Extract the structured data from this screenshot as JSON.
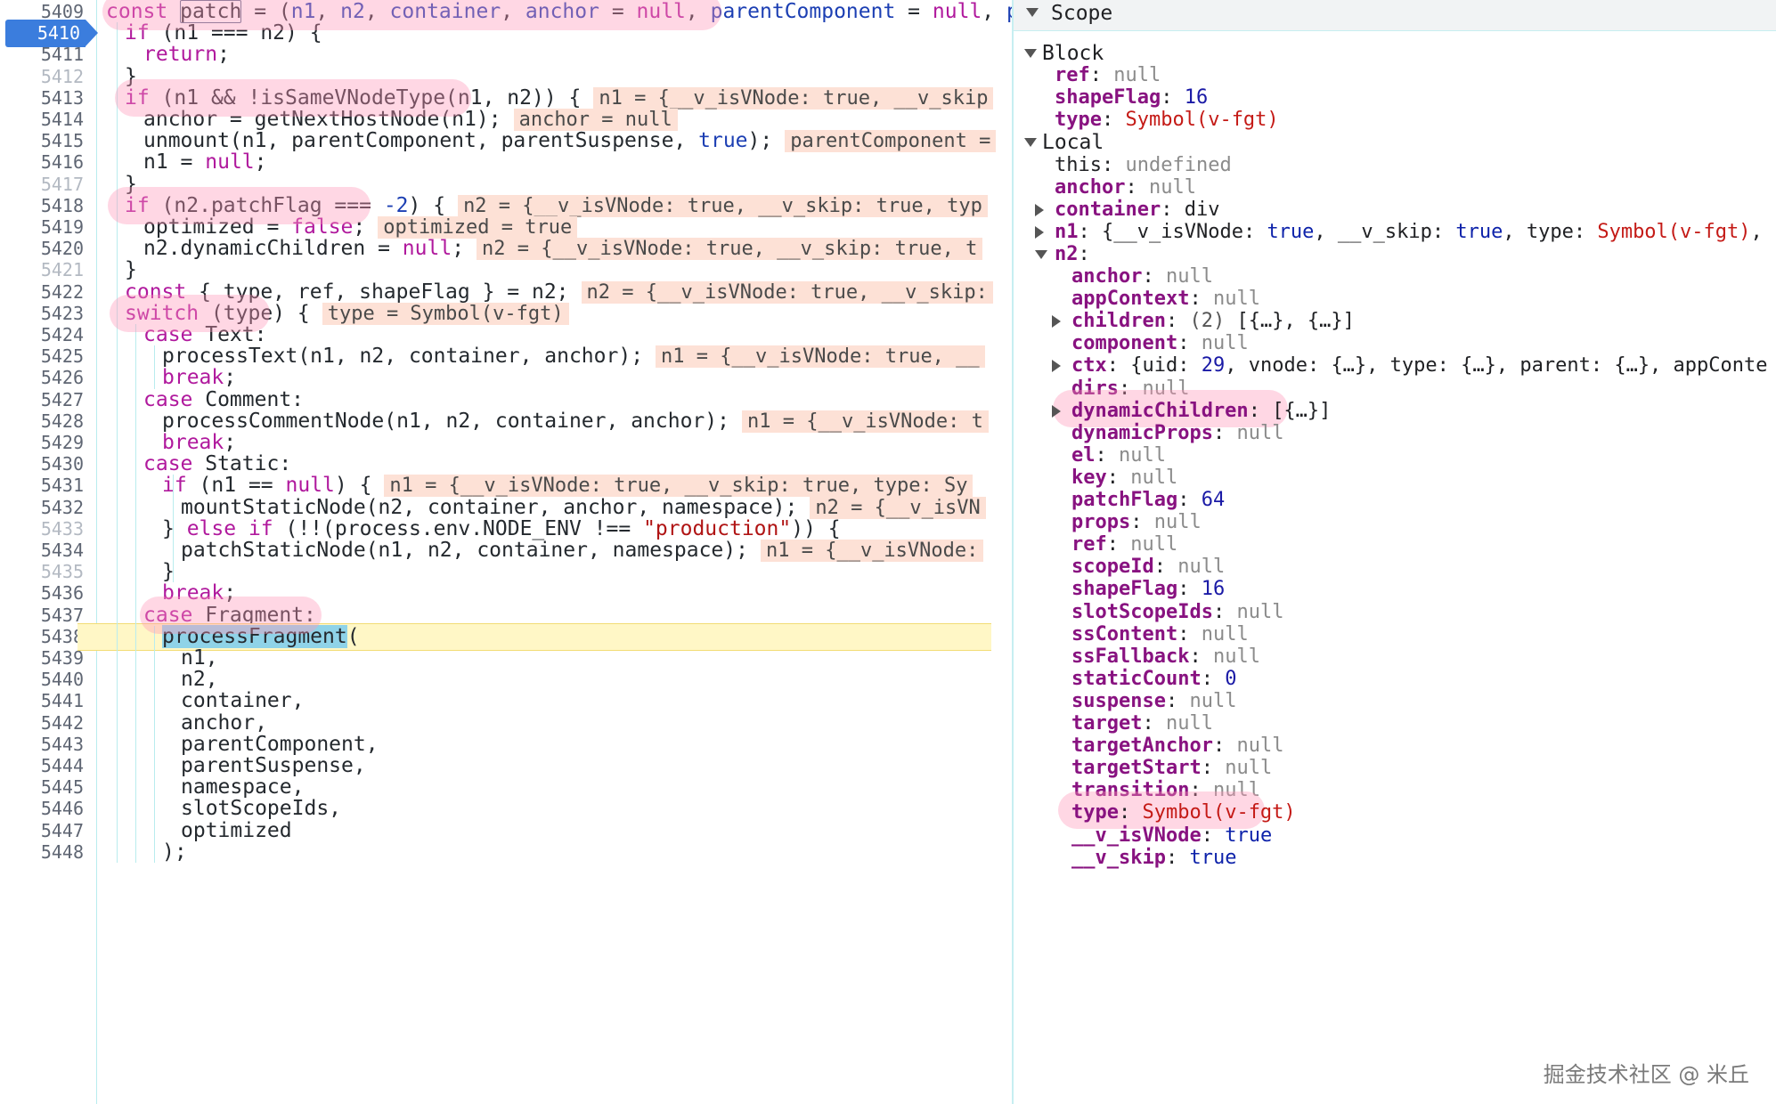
{
  "editor": {
    "active_line": "5410",
    "lines": [
      {
        "n": "5409",
        "dim": false,
        "indent": 0,
        "tokens": [
          [
            "kw",
            "const "
          ],
          [
            "boxfn",
            "patch"
          ],
          [
            "p",
            " = ("
          ],
          [
            "param",
            "n1"
          ],
          [
            "p",
            ", "
          ],
          [
            "param",
            "n2"
          ],
          [
            "p",
            ", "
          ],
          [
            "param",
            "container"
          ],
          [
            "p",
            ", "
          ],
          [
            "param",
            "anchor"
          ],
          [
            "p",
            " = "
          ],
          [
            "kw",
            "null"
          ],
          [
            "p",
            ", "
          ],
          [
            "param",
            "parentComponent"
          ],
          [
            "p",
            " = "
          ],
          [
            "kw",
            "null"
          ],
          [
            "p",
            ", "
          ],
          [
            "param",
            "pa"
          ]
        ],
        "inline": ""
      },
      {
        "n": "5410",
        "dim": false,
        "indent": 1,
        "tokens": [
          [
            "kw",
            "if"
          ],
          [
            "p",
            " (n1 === n2) {"
          ]
        ],
        "inline": ""
      },
      {
        "n": "5411",
        "dim": false,
        "indent": 2,
        "tokens": [
          [
            "kw",
            "return"
          ],
          [
            "p",
            ";"
          ]
        ],
        "inline": ""
      },
      {
        "n": "5412",
        "dim": true,
        "indent": 1,
        "tokens": [
          [
            "p",
            "}"
          ]
        ],
        "inline": ""
      },
      {
        "n": "5413",
        "dim": false,
        "indent": 1,
        "tokens": [
          [
            "kw",
            "if"
          ],
          [
            "p",
            " (n1 && !isSameVNodeType(n1, n2)) {"
          ]
        ],
        "inline": "n1 = {__v_isVNode: true, __v_skip"
      },
      {
        "n": "5414",
        "dim": false,
        "indent": 2,
        "tokens": [
          [
            "p",
            "anchor = getNextHostNode(n1);"
          ]
        ],
        "inline": "anchor = null"
      },
      {
        "n": "5415",
        "dim": false,
        "indent": 2,
        "tokens": [
          [
            "p",
            "unmount(n1, parentComponent, parentSuspense, "
          ],
          [
            "lit",
            "true"
          ],
          [
            "p",
            ");"
          ]
        ],
        "inline": "parentComponent ="
      },
      {
        "n": "5416",
        "dim": false,
        "indent": 2,
        "tokens": [
          [
            "p",
            "n1 = "
          ],
          [
            "kw",
            "null"
          ],
          [
            "p",
            ";"
          ]
        ],
        "inline": ""
      },
      {
        "n": "5417",
        "dim": true,
        "indent": 1,
        "tokens": [
          [
            "p",
            "}"
          ]
        ],
        "inline": ""
      },
      {
        "n": "5418",
        "dim": false,
        "indent": 1,
        "tokens": [
          [
            "kw",
            "if"
          ],
          [
            "p",
            " (n2.patchFlag === "
          ],
          [
            "num",
            "-2"
          ],
          [
            "p",
            ") {"
          ]
        ],
        "inline": "n2 = {__v_isVNode: true, __v_skip: true, typ"
      },
      {
        "n": "5419",
        "dim": false,
        "indent": 2,
        "tokens": [
          [
            "p",
            "optimized = "
          ],
          [
            "kw",
            "false"
          ],
          [
            "p",
            ";"
          ]
        ],
        "inline": "optimized = true"
      },
      {
        "n": "5420",
        "dim": false,
        "indent": 2,
        "tokens": [
          [
            "p",
            "n2.dynamicChildren = "
          ],
          [
            "kw",
            "null"
          ],
          [
            "p",
            ";"
          ]
        ],
        "inline": "n2 = {__v_isVNode: true, __v_skip: true, t"
      },
      {
        "n": "5421",
        "dim": true,
        "indent": 1,
        "tokens": [
          [
            "p",
            "}"
          ]
        ],
        "inline": ""
      },
      {
        "n": "5422",
        "dim": false,
        "indent": 1,
        "tokens": [
          [
            "kw",
            "const"
          ],
          [
            "p",
            " { type, ref, shapeFlag } = n2;"
          ]
        ],
        "inline": "n2 = {__v_isVNode: true, __v_skip:"
      },
      {
        "n": "5423",
        "dim": false,
        "indent": 1,
        "tokens": [
          [
            "kw",
            "switch"
          ],
          [
            "p",
            " (type) {"
          ]
        ],
        "inline": "type = Symbol(v-fgt)"
      },
      {
        "n": "5424",
        "dim": false,
        "indent": 2,
        "tokens": [
          [
            "kw",
            "case"
          ],
          [
            "p",
            " Text:"
          ]
        ],
        "inline": ""
      },
      {
        "n": "5425",
        "dim": false,
        "indent": 3,
        "tokens": [
          [
            "p",
            "processText(n1, n2, container, anchor);"
          ]
        ],
        "inline": "n1 = {__v_isVNode: true, __"
      },
      {
        "n": "5426",
        "dim": false,
        "indent": 3,
        "tokens": [
          [
            "kw",
            "break"
          ],
          [
            "p",
            ";"
          ]
        ],
        "inline": ""
      },
      {
        "n": "5427",
        "dim": false,
        "indent": 2,
        "tokens": [
          [
            "kw",
            "case"
          ],
          [
            "p",
            " Comment:"
          ]
        ],
        "inline": ""
      },
      {
        "n": "5428",
        "dim": false,
        "indent": 3,
        "tokens": [
          [
            "p",
            "processCommentNode(n1, n2, container, anchor);"
          ]
        ],
        "inline": "n1 = {__v_isVNode: t"
      },
      {
        "n": "5429",
        "dim": false,
        "indent": 3,
        "tokens": [
          [
            "kw",
            "break"
          ],
          [
            "p",
            ";"
          ]
        ],
        "inline": ""
      },
      {
        "n": "5430",
        "dim": false,
        "indent": 2,
        "tokens": [
          [
            "kw",
            "case"
          ],
          [
            "p",
            " Static:"
          ]
        ],
        "inline": ""
      },
      {
        "n": "5431",
        "dim": false,
        "indent": 3,
        "tokens": [
          [
            "kw",
            "if"
          ],
          [
            "p",
            " (n1 == "
          ],
          [
            "kw",
            "null"
          ],
          [
            "p",
            ") {"
          ]
        ],
        "inline": "n1 = {__v_isVNode: true, __v_skip: true, type: Sy"
      },
      {
        "n": "5432",
        "dim": false,
        "indent": 4,
        "tokens": [
          [
            "p",
            "mountStaticNode(n2, container, anchor, namespace);"
          ]
        ],
        "inline": "n2 = {__v_isVN"
      },
      {
        "n": "5433",
        "dim": true,
        "indent": 3,
        "tokens": [
          [
            "p",
            "} "
          ],
          [
            "kw",
            "else if"
          ],
          [
            "p",
            " (!!(process.env.NODE_ENV !== "
          ],
          [
            "str",
            "\"production\""
          ],
          [
            "p",
            ")) {"
          ]
        ],
        "inline": ""
      },
      {
        "n": "5434",
        "dim": false,
        "indent": 4,
        "tokens": [
          [
            "p",
            "patchStaticNode(n1, n2, container, namespace);"
          ]
        ],
        "inline": "n1 = {__v_isVNode:"
      },
      {
        "n": "5435",
        "dim": true,
        "indent": 3,
        "tokens": [
          [
            "p",
            "}"
          ]
        ],
        "inline": ""
      },
      {
        "n": "5436",
        "dim": false,
        "indent": 3,
        "tokens": [
          [
            "kw",
            "break"
          ],
          [
            "p",
            ";"
          ]
        ],
        "inline": ""
      },
      {
        "n": "5437",
        "dim": false,
        "indent": 2,
        "tokens": [
          [
            "kw",
            "case"
          ],
          [
            "p",
            " Fragment:"
          ]
        ],
        "inline": ""
      },
      {
        "n": "5438",
        "dim": false,
        "indent": 3,
        "tokens": [
          [
            "fnsel",
            "processFragment"
          ],
          [
            "p",
            "("
          ]
        ],
        "inline": ""
      },
      {
        "n": "5439",
        "dim": false,
        "indent": 4,
        "tokens": [
          [
            "p",
            "n1,"
          ]
        ],
        "inline": ""
      },
      {
        "n": "5440",
        "dim": false,
        "indent": 4,
        "tokens": [
          [
            "p",
            "n2,"
          ]
        ],
        "inline": ""
      },
      {
        "n": "5441",
        "dim": false,
        "indent": 4,
        "tokens": [
          [
            "p",
            "container,"
          ]
        ],
        "inline": ""
      },
      {
        "n": "5442",
        "dim": false,
        "indent": 4,
        "tokens": [
          [
            "p",
            "anchor,"
          ]
        ],
        "inline": ""
      },
      {
        "n": "5443",
        "dim": false,
        "indent": 4,
        "tokens": [
          [
            "p",
            "parentComponent,"
          ]
        ],
        "inline": ""
      },
      {
        "n": "5444",
        "dim": false,
        "indent": 4,
        "tokens": [
          [
            "p",
            "parentSuspense,"
          ]
        ],
        "inline": ""
      },
      {
        "n": "5445",
        "dim": false,
        "indent": 4,
        "tokens": [
          [
            "p",
            "namespace,"
          ]
        ],
        "inline": ""
      },
      {
        "n": "5446",
        "dim": false,
        "indent": 4,
        "tokens": [
          [
            "p",
            "slotScopeIds,"
          ]
        ],
        "inline": ""
      },
      {
        "n": "5447",
        "dim": false,
        "indent": 4,
        "tokens": [
          [
            "p",
            "optimized"
          ]
        ],
        "inline": ""
      },
      {
        "n": "5448",
        "dim": false,
        "indent": 3,
        "tokens": [
          [
            "p",
            ");"
          ]
        ],
        "inline": ""
      }
    ]
  },
  "scope": {
    "title": "Scope",
    "rows": [
      {
        "kind": "section",
        "label": "Block",
        "level": 0,
        "expander": "down"
      },
      {
        "kind": "prop",
        "key": "ref",
        "value": "null",
        "vtype": "null",
        "level": 1,
        "expander": ""
      },
      {
        "kind": "prop",
        "key": "shapeFlag",
        "value": "16",
        "vtype": "num",
        "level": 1,
        "expander": ""
      },
      {
        "kind": "prop",
        "key": "type",
        "value": "Symbol(v-fgt)",
        "vtype": "sym",
        "level": 1,
        "expander": ""
      },
      {
        "kind": "section",
        "label": "Local",
        "level": 0,
        "expander": "down"
      },
      {
        "kind": "plainkey",
        "key": "this",
        "value": "undefined",
        "vtype": "null",
        "level": 1,
        "expander": ""
      },
      {
        "kind": "prop",
        "key": "anchor",
        "value": "null",
        "vtype": "null",
        "level": 1,
        "expander": ""
      },
      {
        "kind": "prop",
        "key": "container",
        "value": "div",
        "vtype": "plain",
        "level": 1,
        "expander": "right"
      },
      {
        "kind": "rich",
        "key": "n1",
        "level": 1,
        "expander": "right",
        "parts": [
          [
            "plain",
            "{__v_isVNode: "
          ],
          [
            "kw",
            "true"
          ],
          [
            "plain",
            ", __v_skip: "
          ],
          [
            "kw",
            "true"
          ],
          [
            "plain",
            ", type: "
          ],
          [
            "sym",
            "Symbol(v-fgt)"
          ],
          [
            "plain",
            ","
          ]
        ]
      },
      {
        "kind": "prop",
        "key": "n2",
        "value": "",
        "vtype": "plain",
        "level": 1,
        "expander": "down"
      },
      {
        "kind": "prop",
        "key": "anchor",
        "value": "null",
        "vtype": "null",
        "level": 2,
        "expander": ""
      },
      {
        "kind": "prop",
        "key": "appContext",
        "value": "null",
        "vtype": "null",
        "level": 2,
        "expander": ""
      },
      {
        "kind": "rich",
        "key": "children",
        "level": 2,
        "expander": "right",
        "parts": [
          [
            "arr",
            "(2) "
          ],
          [
            "plain",
            "[{…}, {…}]"
          ]
        ]
      },
      {
        "kind": "prop",
        "key": "component",
        "value": "null",
        "vtype": "null",
        "level": 2,
        "expander": ""
      },
      {
        "kind": "rich",
        "key": "ctx",
        "level": 2,
        "expander": "right",
        "parts": [
          [
            "plain",
            "{uid: "
          ],
          [
            "num",
            "29"
          ],
          [
            "plain",
            ", vnode: {…}, type: {…}, parent: {…}, appConte"
          ]
        ]
      },
      {
        "kind": "prop",
        "key": "dirs",
        "value": "null",
        "vtype": "null",
        "level": 2,
        "expander": ""
      },
      {
        "kind": "prop",
        "key": "dynamicChildren",
        "value": "[{…}]",
        "vtype": "plain",
        "level": 2,
        "expander": "right"
      },
      {
        "kind": "prop",
        "key": "dynamicProps",
        "value": "null",
        "vtype": "null",
        "level": 2,
        "expander": ""
      },
      {
        "kind": "prop",
        "key": "el",
        "value": "null",
        "vtype": "null",
        "level": 2,
        "expander": ""
      },
      {
        "kind": "prop",
        "key": "key",
        "value": "null",
        "vtype": "null",
        "level": 2,
        "expander": ""
      },
      {
        "kind": "prop",
        "key": "patchFlag",
        "value": "64",
        "vtype": "num",
        "level": 2,
        "expander": ""
      },
      {
        "kind": "prop",
        "key": "props",
        "value": "null",
        "vtype": "null",
        "level": 2,
        "expander": ""
      },
      {
        "kind": "prop",
        "key": "ref",
        "value": "null",
        "vtype": "null",
        "level": 2,
        "expander": ""
      },
      {
        "kind": "prop",
        "key": "scopeId",
        "value": "null",
        "vtype": "null",
        "level": 2,
        "expander": ""
      },
      {
        "kind": "prop",
        "key": "shapeFlag",
        "value": "16",
        "vtype": "num",
        "level": 2,
        "expander": ""
      },
      {
        "kind": "prop",
        "key": "slotScopeIds",
        "value": "null",
        "vtype": "null",
        "level": 2,
        "expander": ""
      },
      {
        "kind": "prop",
        "key": "ssContent",
        "value": "null",
        "vtype": "null",
        "level": 2,
        "expander": ""
      },
      {
        "kind": "prop",
        "key": "ssFallback",
        "value": "null",
        "vtype": "null",
        "level": 2,
        "expander": ""
      },
      {
        "kind": "prop",
        "key": "staticCount",
        "value": "0",
        "vtype": "num",
        "level": 2,
        "expander": ""
      },
      {
        "kind": "prop",
        "key": "suspense",
        "value": "null",
        "vtype": "null",
        "level": 2,
        "expander": ""
      },
      {
        "kind": "prop",
        "key": "target",
        "value": "null",
        "vtype": "null",
        "level": 2,
        "expander": ""
      },
      {
        "kind": "prop",
        "key": "targetAnchor",
        "value": "null",
        "vtype": "null",
        "level": 2,
        "expander": ""
      },
      {
        "kind": "prop",
        "key": "targetStart",
        "value": "null",
        "vtype": "null",
        "level": 2,
        "expander": ""
      },
      {
        "kind": "prop",
        "key": "transition",
        "value": "null",
        "vtype": "null",
        "level": 2,
        "expander": ""
      },
      {
        "kind": "prop",
        "key": "type",
        "value": "Symbol(v-fgt)",
        "vtype": "sym",
        "level": 2,
        "expander": ""
      },
      {
        "kind": "prop",
        "key": "__v_isVNode",
        "value": "true",
        "vtype": "kw",
        "level": 2,
        "expander": ""
      },
      {
        "kind": "prop",
        "key": "__v_skip",
        "value": "true",
        "vtype": "kw",
        "level": 2,
        "expander": ""
      }
    ]
  },
  "watermark": "掘金技术社区 @ 米丘"
}
